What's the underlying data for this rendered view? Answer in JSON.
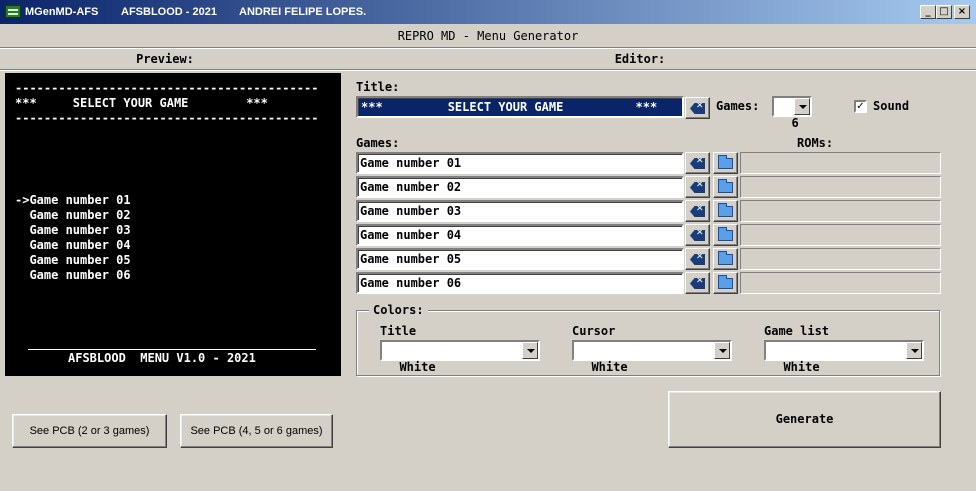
{
  "window": {
    "title_app": "MGenMD-AFS",
    "title_credit": "AFSBLOOD - 2021",
    "title_author": "ANDREI FELIPE LOPES.",
    "minimize_glyph": "_",
    "maximize_glyph": "□",
    "close_glyph": "×"
  },
  "app_subtitle": "REPRO MD - Menu Generator",
  "headers": {
    "preview": "Preview:",
    "editor": "Editor:"
  },
  "preview": {
    "dashes_top": "------------------------------------------",
    "title_line": "***     SELECT YOUR GAME        ***",
    "dashes_bottom": "------------------------------------------",
    "items": [
      "->Game number 01",
      "  Game number 02",
      "  Game number 03",
      "  Game number 04",
      "  Game number 05",
      "  Game number 06"
    ],
    "footer": "AFSBLOOD  MENU V1.0 - 2021"
  },
  "editor": {
    "title_label": "Title:",
    "title_value": "***         SELECT YOUR GAME          ***",
    "games_count_label": "Games:",
    "games_count_value": "6",
    "sound_label": "Sound",
    "sound_checked": "✓",
    "games_label": "Games:",
    "roms_label": "ROMs:",
    "games": [
      {
        "name": "Game number 01",
        "rom": ""
      },
      {
        "name": "Game number 02",
        "rom": ""
      },
      {
        "name": "Game number 03",
        "rom": ""
      },
      {
        "name": "Game number 04",
        "rom": ""
      },
      {
        "name": "Game number 05",
        "rom": ""
      },
      {
        "name": "Game number 06",
        "rom": ""
      }
    ]
  },
  "colors": {
    "group_label": "Colors:",
    "title_label": "Title",
    "title_value": "White",
    "cursor_label": "Cursor",
    "cursor_value": "White",
    "gamelist_label": "Game list",
    "gamelist_value": "White"
  },
  "buttons": {
    "pcb_small": "See PCB (2 or 3 games)",
    "pcb_large": "See PCB (4, 5 or 6 games)",
    "generate": "Generate"
  },
  "theme": {
    "face": "#d4d0c8",
    "titlebar_start": "#0a246a",
    "titlebar_end": "#a6caf0",
    "selection": "#0a246a",
    "preview_bg": "#000000"
  }
}
